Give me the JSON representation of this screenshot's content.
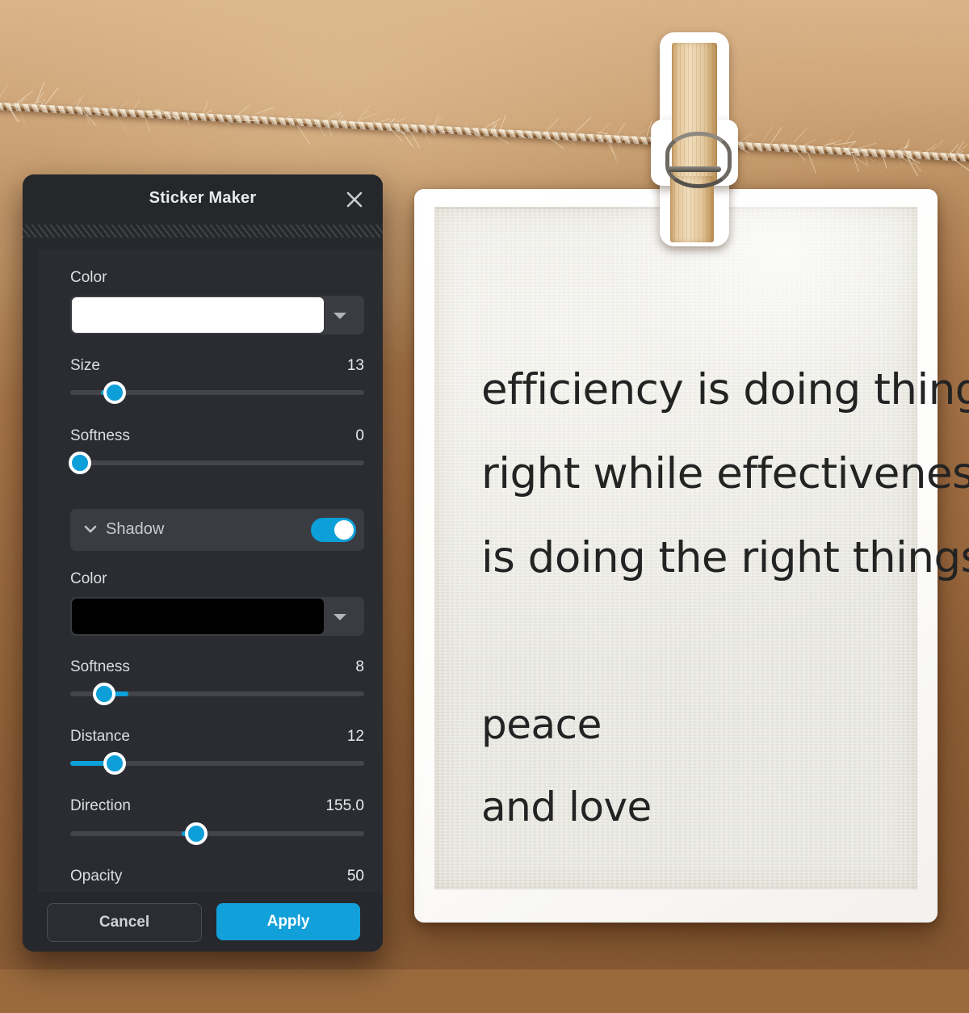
{
  "dialog": {
    "title": "Sticker Maker",
    "close_icon": "close-icon",
    "sections": {
      "main": {
        "color_label": "Color",
        "color_value": "#ffffff",
        "dropdown_icon": "chevron-down-icon",
        "sliders": [
          {
            "label": "Size",
            "value": "13"
          },
          {
            "label": "Softness",
            "value": "0"
          }
        ]
      },
      "shadow": {
        "header_label": "Shadow",
        "collapse_icon": "chevron-down-icon",
        "enabled": true,
        "color_label": "Color",
        "color_value": "#000000",
        "dropdown_icon": "chevron-down-icon",
        "sliders": [
          {
            "label": "Softness",
            "value": "8"
          },
          {
            "label": "Distance",
            "value": "12"
          },
          {
            "label": "Direction",
            "value": "155.0"
          },
          {
            "label": "Opacity",
            "value": "50"
          }
        ]
      }
    },
    "footer": {
      "cancel_label": "Cancel",
      "apply_label": "Apply"
    },
    "accent_color": "#0d9fd8",
    "panel_color": "#26282d"
  },
  "canvas": {
    "quote_lines": [
      "efficiency is doing things",
      "right while effectiveness",
      "is doing the right things"
    ],
    "tag_lines": [
      "peace",
      "and love"
    ],
    "sticker_icon": "pencil-sticker",
    "clothespin_icon": "clothespin",
    "twine_icon": "twine-rope"
  }
}
